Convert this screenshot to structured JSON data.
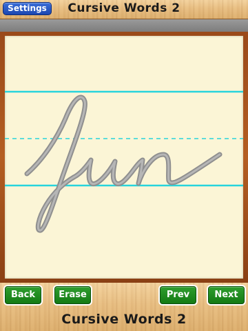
{
  "app": {
    "title_top": "Cursive Words 2",
    "title_bottom": "Cursive Words 2"
  },
  "toolbar": {
    "settings_label": "Settings"
  },
  "board": {
    "word": "fun",
    "colors": {
      "paper": "#fbf5d6",
      "guide_line": "#27d4dc",
      "letter_stroke": "#9a9a9a",
      "frame": "#a5521d"
    }
  },
  "nav": {
    "back_label": "Back",
    "erase_label": "Erase",
    "prev_label": "Prev",
    "next_label": "Next",
    "button_color": "#1a8a1a"
  }
}
